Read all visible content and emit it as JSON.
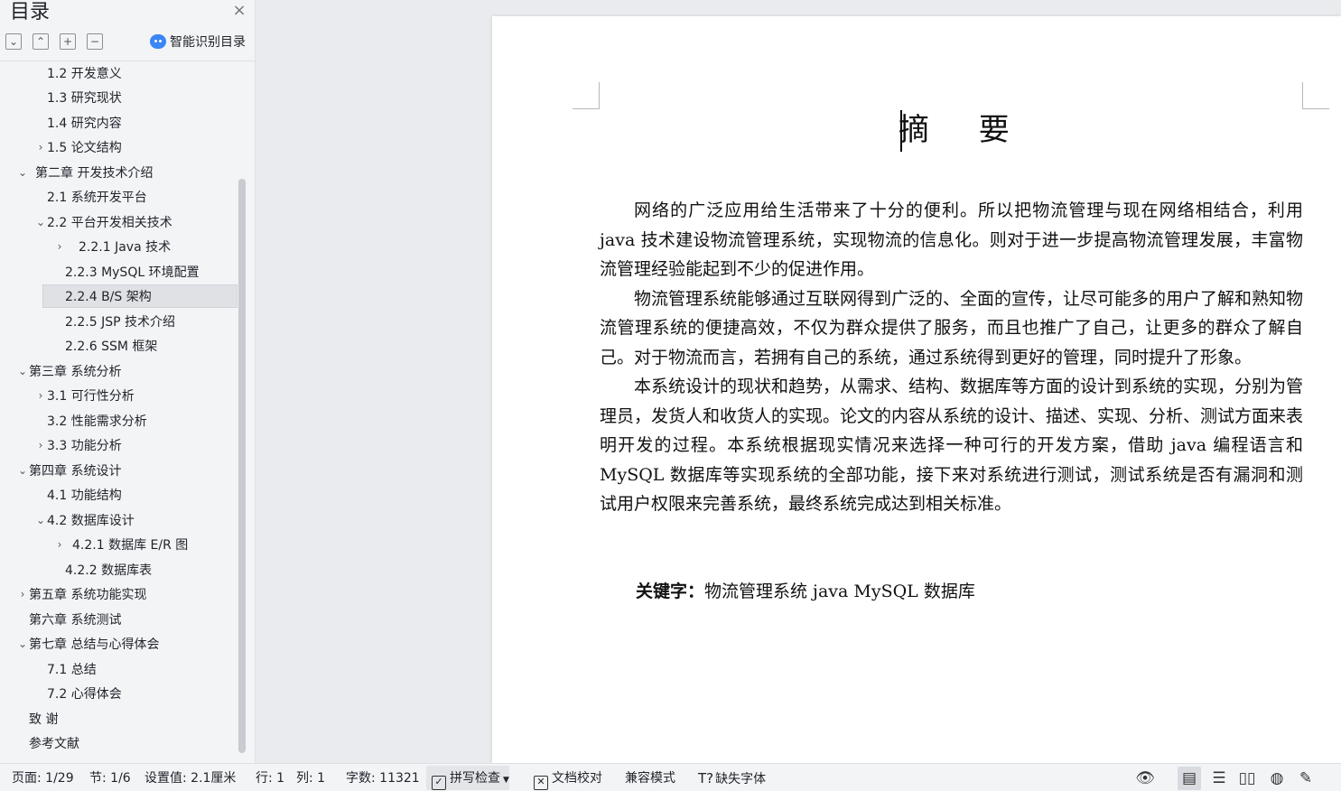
{
  "sidebar": {
    "title": "目录",
    "close_icon": "×",
    "tools": [
      "⌄",
      "⌃",
      "+",
      "−"
    ],
    "smart_label": "智能识别目录",
    "toc": [
      {
        "label": "1.2  开发意义",
        "chev": ""
      },
      {
        "label": "1.3  研究现状",
        "chev": ""
      },
      {
        "label": "1.4  研究内容",
        "chev": ""
      },
      {
        "label": "1.5  论文结构",
        "chev": "›"
      },
      {
        "label": "第二章  开发技术介绍",
        "chev": "⌄"
      },
      {
        "label": "2.1  系统开发平台",
        "chev": ""
      },
      {
        "label": "2.2  平台开发相关技术",
        "chev": "⌄"
      },
      {
        "label": "2.2.1    Java 技术",
        "chev": "›"
      },
      {
        "label": "2.2.3    MySQL 环境配置",
        "chev": ""
      },
      {
        "label": "2.2.4    B/S 架构",
        "chev": ""
      },
      {
        "label": "2.2.5    JSP 技术介绍",
        "chev": ""
      },
      {
        "label": "2.2.6    SSM 框架",
        "chev": ""
      },
      {
        "label": "第三章  系统分析",
        "chev": "⌄"
      },
      {
        "label": "3.1  可行性分析",
        "chev": "›"
      },
      {
        "label": "3.2 性能需求分析",
        "chev": ""
      },
      {
        "label": "3.3 功能分析",
        "chev": "›"
      },
      {
        "label": "第四章  系统设计",
        "chev": "⌄"
      },
      {
        "label": "4.1 功能结构",
        "chev": ""
      },
      {
        "label": "4.2  数据库设计",
        "chev": "⌄"
      },
      {
        "label": "4.2.1  数据库 E/R 图",
        "chev": "›"
      },
      {
        "label": "4.2.2  数据库表",
        "chev": ""
      },
      {
        "label": "第五章  系统功能实现",
        "chev": "›"
      },
      {
        "label": "第六章  系统测试",
        "chev": ""
      },
      {
        "label": "第七章  总结与心得体会",
        "chev": "⌄"
      },
      {
        "label": "7.1  总结",
        "chev": ""
      },
      {
        "label": "7.2  心得体会",
        "chev": ""
      },
      {
        "label": "致    谢",
        "chev": ""
      },
      {
        "label": "参考文献",
        "chev": ""
      }
    ]
  },
  "document": {
    "title": "摘  要",
    "paragraphs": [
      "网络的广泛应用给生活带来了十分的便利。所以把物流管理与现在网络相结合，利用 java 技术建设物流管理系统，实现物流的信息化。则对于进一步提高物流管理发展，丰富物流管理经验能起到不少的促进作用。",
      "物流管理系统能够通过互联网得到广泛的、全面的宣传，让尽可能多的用户了解和熟知物流管理系统的便捷高效，不仅为群众提供了服务，而且也推广了自己，让更多的群众了解自己。对于物流而言，若拥有自己的系统，通过系统得到更好的管理，同时提升了形象。",
      "本系统设计的现状和趋势，从需求、结构、数据库等方面的设计到系统的实现，分别为管理员，发货人和收货人的实现。论文的内容从系统的设计、描述、实现、分析、测试方面来表明开发的过程。本系统根据现实情况来选择一种可行的开发方案，借助 java 编程语言和 MySQL 数据库等实现系统的全部功能，接下来对系统进行测试，测试系统是否有漏洞和测试用户权限来完善系统，最终系统完成达到相关标准。"
    ],
    "keywords_label": "关键字：",
    "keywords_value": "物流管理系统  java  MySQL 数据库"
  },
  "status": {
    "page": "页面: 1/29",
    "section": "节: 1/6",
    "setting": "设置值: 2.1厘米",
    "row": "行: 1",
    "col": "列: 1",
    "words": "字数: 11321",
    "spell": "拼写检查",
    "proof": "文档校对",
    "compat": "兼容模式",
    "missing_font": "缺失字体"
  }
}
